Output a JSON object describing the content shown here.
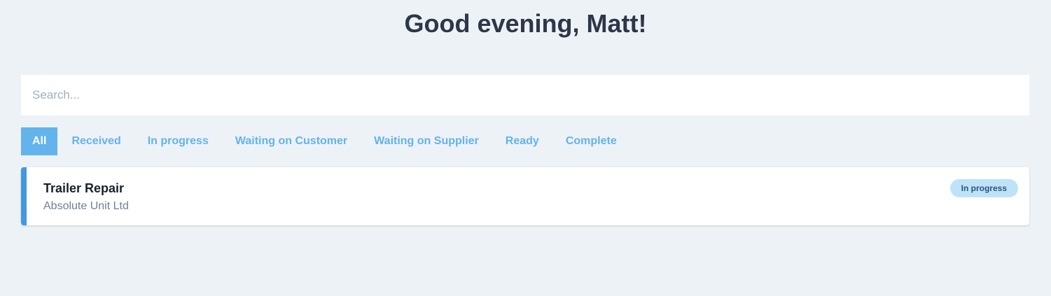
{
  "header": {
    "greeting": "Good evening, Matt!"
  },
  "search": {
    "value": "",
    "placeholder": "Search..."
  },
  "filters": {
    "tabs": [
      {
        "label": "All",
        "active": true
      },
      {
        "label": "Received",
        "active": false
      },
      {
        "label": "In progress",
        "active": false
      },
      {
        "label": "Waiting on Customer",
        "active": false
      },
      {
        "label": "Waiting on Supplier",
        "active": false
      },
      {
        "label": "Ready",
        "active": false
      },
      {
        "label": "Complete",
        "active": false
      }
    ]
  },
  "jobs": [
    {
      "title": "Trailer Repair",
      "customer": "Absolute Unit Ltd",
      "status": "In progress"
    }
  ],
  "colors": {
    "background": "#edf2f7",
    "accent": "#63b3ed",
    "card_border": "#4299e1",
    "status_badge_bg": "#bee3f8",
    "status_badge_text": "#2c5282"
  }
}
